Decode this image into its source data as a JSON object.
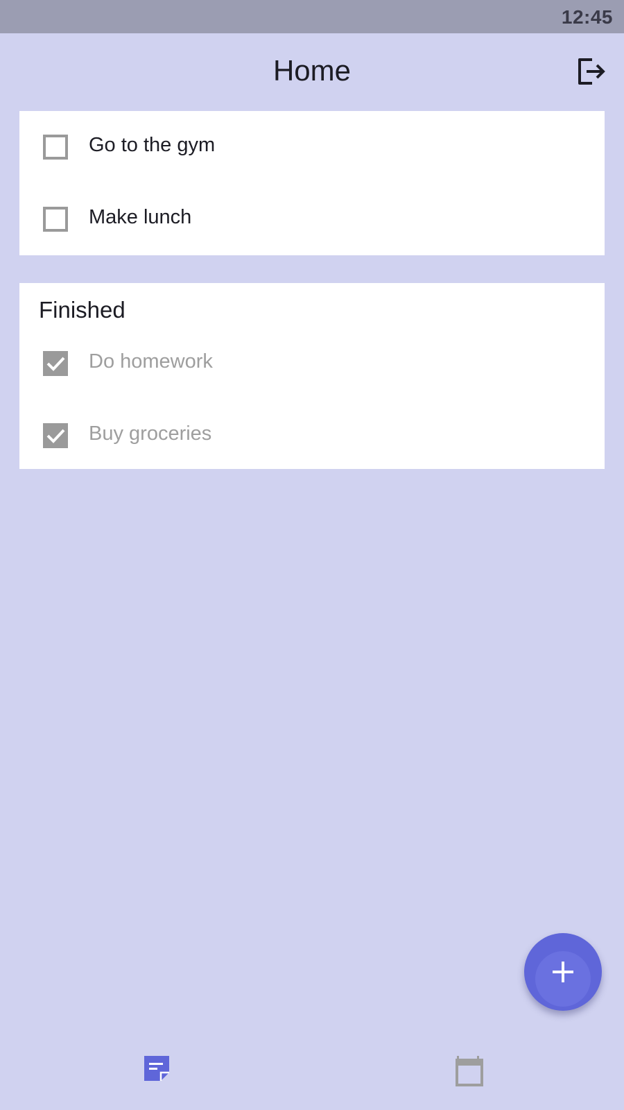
{
  "status_bar": {
    "time": "12:45"
  },
  "app_bar": {
    "title": "Home",
    "logout_icon": "logout-icon"
  },
  "active_tasks": [
    {
      "label": "Go to the gym",
      "checked": false
    },
    {
      "label": "Make lunch",
      "checked": false
    }
  ],
  "finished": {
    "title": "Finished",
    "tasks": [
      {
        "label": "Do homework",
        "checked": true
      },
      {
        "label": "Buy groceries",
        "checked": true
      }
    ]
  },
  "fab": {
    "icon": "plus-icon"
  },
  "bottom_nav": {
    "items": [
      {
        "icon": "notes-icon",
        "active": true
      },
      {
        "icon": "calendar-icon",
        "active": false
      }
    ]
  },
  "colors": {
    "background": "#d0d2f0",
    "status_bar": "#9b9db2",
    "accent": "#5f66d9",
    "checkbox": "#9a9a9a",
    "inactive_icon": "#9e9e9e"
  }
}
